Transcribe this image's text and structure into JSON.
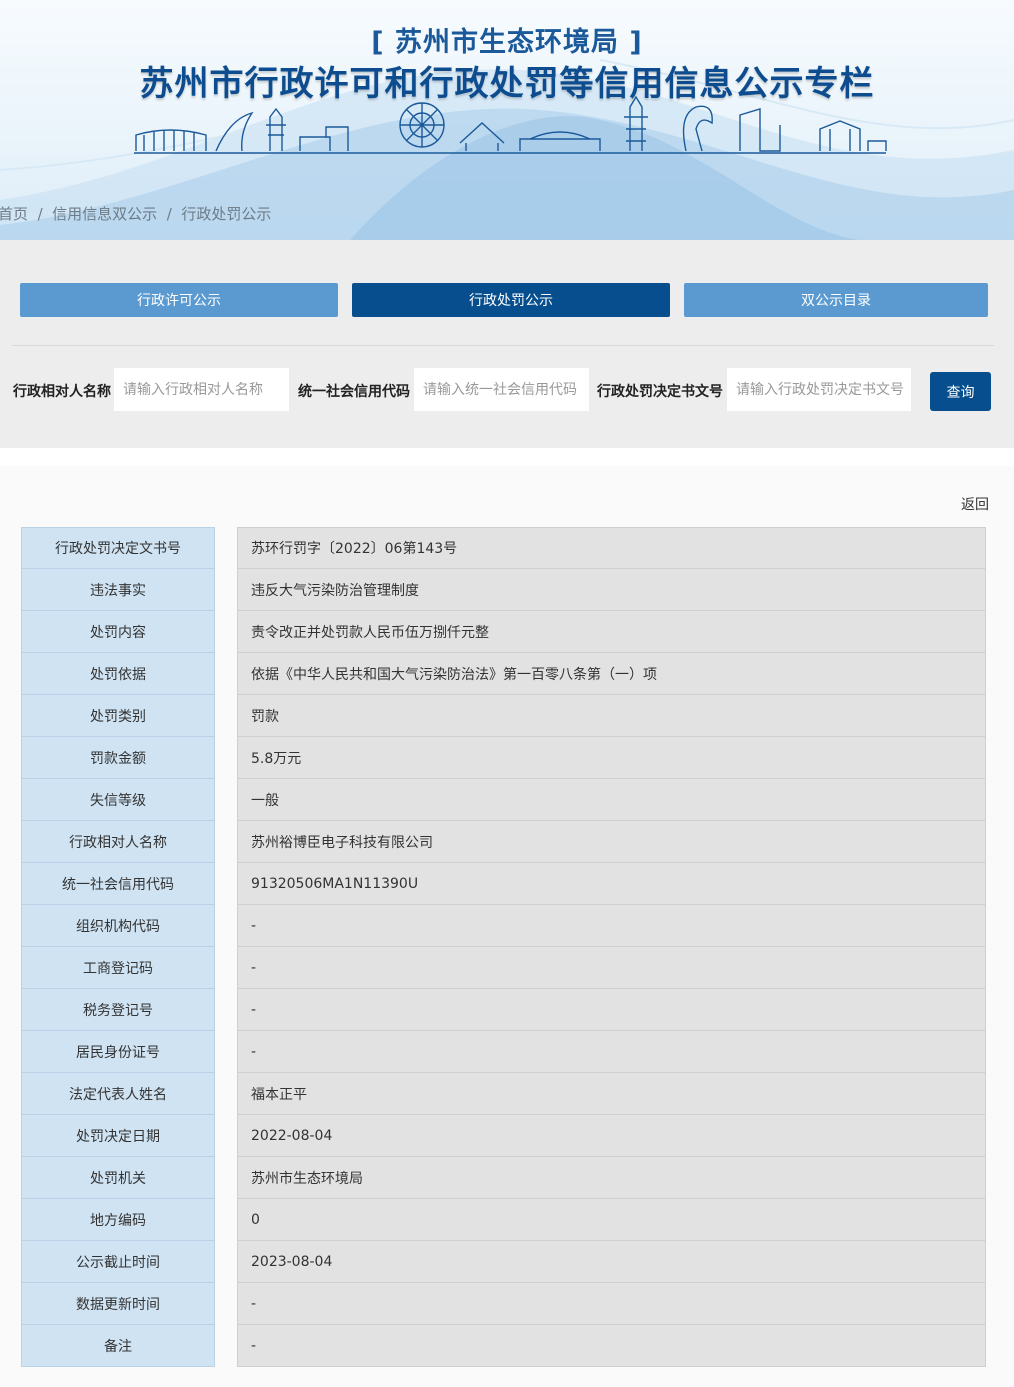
{
  "header": {
    "subtitle": "[ 苏州市生态环境局 ]",
    "title": "苏州市行政许可和行政处罚等信用信息公示专栏"
  },
  "breadcrumb": [
    "首页",
    "信用信息双公示",
    "行政处罚公示"
  ],
  "tabs": [
    {
      "label": "行政许可公示",
      "active": false
    },
    {
      "label": "行政处罚公示",
      "active": true
    },
    {
      "label": "双公示目录",
      "active": false
    }
  ],
  "search": {
    "fields": [
      {
        "label": "行政相对人名称",
        "placeholder": "请输入行政相对人名称",
        "value": ""
      },
      {
        "label": "统一社会信用代码",
        "placeholder": "请输入统一社会信用代码",
        "value": ""
      },
      {
        "label": "行政处罚决定书文号",
        "placeholder": "请输入行政处罚决定书文号",
        "value": ""
      }
    ],
    "button_label": "查询"
  },
  "back_label": "返回",
  "detail_rows": [
    {
      "label": "行政处罚决定文书号",
      "value": "苏环行罚字〔2022〕06第143号"
    },
    {
      "label": "违法事实",
      "value": "违反大气污染防治管理制度"
    },
    {
      "label": "处罚内容",
      "value": "责令改正并处罚款人民币伍万捌仟元整"
    },
    {
      "label": "处罚依据",
      "value": "依据《中华人民共和国大气污染防治法》第一百零八条第（一）项"
    },
    {
      "label": "处罚类别",
      "value": "罚款"
    },
    {
      "label": "罚款金额",
      "value": "5.8万元"
    },
    {
      "label": "失信等级",
      "value": "一般"
    },
    {
      "label": "行政相对人名称",
      "value": "苏州裕博臣电子科技有限公司"
    },
    {
      "label": "统一社会信用代码",
      "value": "91320506MA1N11390U"
    },
    {
      "label": "组织机构代码",
      "value": "-"
    },
    {
      "label": "工商登记码",
      "value": "-"
    },
    {
      "label": "税务登记号",
      "value": "-"
    },
    {
      "label": "居民身份证号",
      "value": "-"
    },
    {
      "label": "法定代表人姓名",
      "value": "福本正平"
    },
    {
      "label": "处罚决定日期",
      "value": "2022-08-04"
    },
    {
      "label": "处罚机关",
      "value": "苏州市生态环境局"
    },
    {
      "label": "地方编码",
      "value": "0"
    },
    {
      "label": "公示截止时间",
      "value": "2023-08-04"
    },
    {
      "label": "数据更新时间",
      "value": "-"
    },
    {
      "label": "备注",
      "value": "-"
    }
  ],
  "colors": {
    "tab_active": "#064e8e",
    "tab_inactive": "#5b9ad1",
    "label_cell": "#cfe3f3",
    "value_cell": "#e2e2e2",
    "title": "#0d4d8f"
  }
}
